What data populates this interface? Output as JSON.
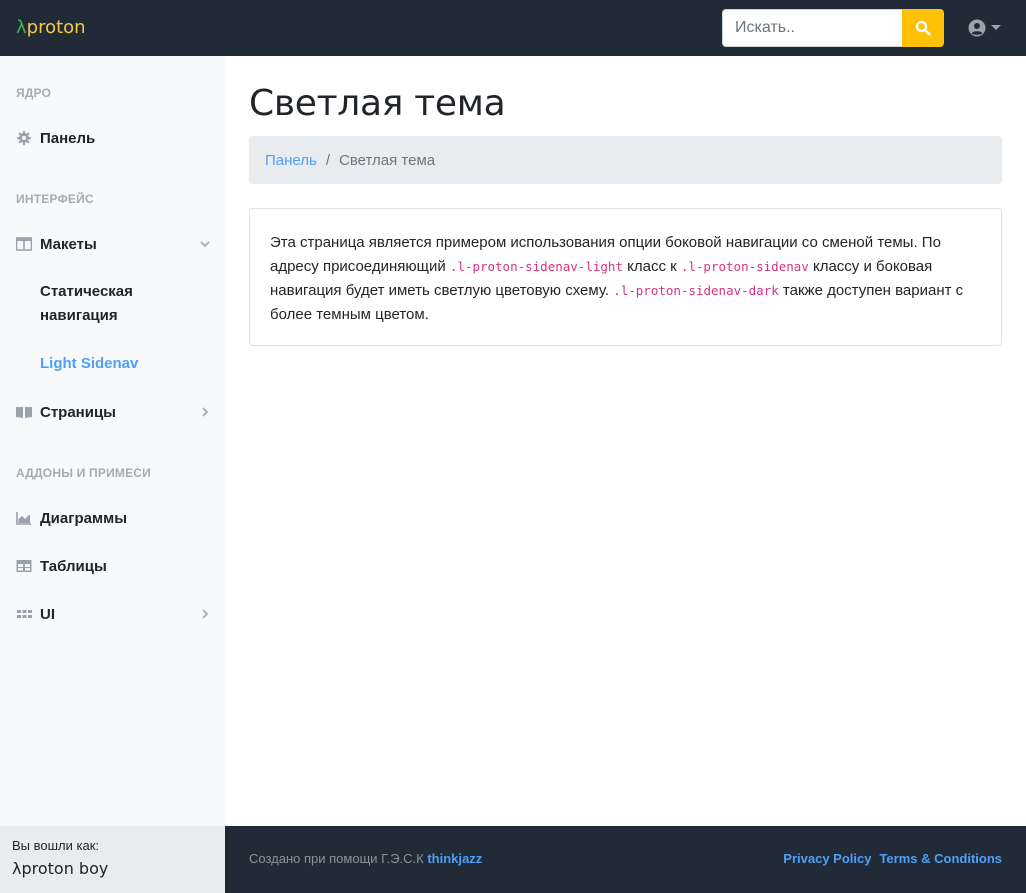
{
  "navbar": {
    "brand_lambda": "λ",
    "brand_text": "proton",
    "search": {
      "placeholder": "Искать..",
      "value": ""
    },
    "search_button_icon": "search-icon",
    "user_menu_icon": "user-circle-icon"
  },
  "sidebar": {
    "headings": {
      "core": "ЯДРО",
      "interface": "ИНТЕРФЕЙС",
      "addons": "АДДОНЫ И ПРИМЕСИ"
    },
    "items": {
      "dashboard": {
        "label": "Панель",
        "icon": "gear-icon"
      },
      "layouts": {
        "label": "Макеты",
        "icon": "columns-icon",
        "expanded": true
      },
      "static_nav": {
        "label": "Статическая навигация"
      },
      "light_sidenav": {
        "label": "Light Sidenav",
        "active": true
      },
      "pages": {
        "label": "Страницы",
        "icon": "book-icon"
      },
      "charts": {
        "label": "Диаграммы",
        "icon": "area-chart-icon"
      },
      "tables": {
        "label": "Таблицы",
        "icon": "table-icon"
      },
      "ui": {
        "label": "UI",
        "icon": "grid-icon"
      }
    },
    "footer": {
      "logged_in_label": "Вы вошли как:",
      "user_name": "λproton boy"
    }
  },
  "main": {
    "title": "Светлая тема",
    "breadcrumb": {
      "parent": "Панель",
      "separator": "/",
      "current": "Светлая тема"
    },
    "card": {
      "text_1": "Эта страница является примером использования опции боковой навигации со сменой темы. По адресу присоединяющий ",
      "code_1": ".l-proton-sidenav-light",
      "text_2": " класс к ",
      "code_2": ".l-proton-sidenav",
      "text_3": " классу и боковая навигация будет иметь светлую цветовую схему. ",
      "code_3": ".l-proton-sidenav-dark",
      "text_4": " также доступен вариант с более темным цветом."
    }
  },
  "footer": {
    "credits_prefix": "Создано при помощи Г.Э.С.К ",
    "credits_author": "thinkjazz",
    "privacy": "Privacy Policy",
    "terms": "Terms & Conditions"
  },
  "colors": {
    "navbar_bg": "#212b38",
    "accent_yellow": "#ffc107",
    "link_blue": "#4e9ff5",
    "code_pink": "#d63384",
    "sidebar_bg": "#f8f9fa"
  }
}
